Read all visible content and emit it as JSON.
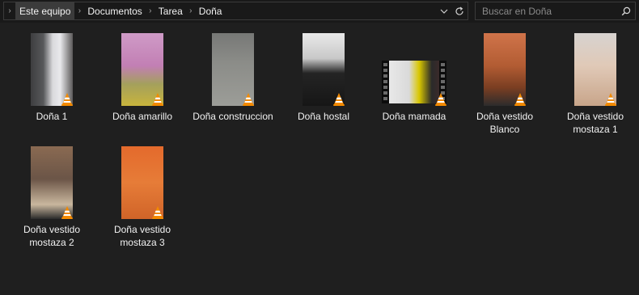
{
  "address_bar": {
    "breadcrumbs": [
      "Este equipo",
      "Documentos",
      "Tarea",
      "Doña"
    ],
    "dropdown_icon": "chevron-down-icon",
    "refresh_icon": "refresh-icon"
  },
  "search": {
    "placeholder": "Buscar en Doña",
    "value": "",
    "icon": "search-icon"
  },
  "files": [
    {
      "name": "Doña 1",
      "type": "video",
      "icon": "vlc-cone-icon"
    },
    {
      "name": "Doña amarillo",
      "type": "video",
      "icon": "vlc-cone-icon"
    },
    {
      "name": "Doña construccion",
      "type": "video",
      "icon": "vlc-cone-icon"
    },
    {
      "name": "Doña hostal",
      "type": "video",
      "icon": "vlc-cone-icon"
    },
    {
      "name": "Doña mamada",
      "type": "video",
      "icon": "vlc-cone-icon"
    },
    {
      "name": "Doña vestido Blanco",
      "type": "video",
      "icon": "vlc-cone-icon"
    },
    {
      "name": "Doña vestido mostaza 1",
      "type": "video",
      "icon": "vlc-cone-icon"
    },
    {
      "name": "Doña vestido mostaza 2",
      "type": "video",
      "icon": "vlc-cone-icon"
    },
    {
      "name": "Doña vestido mostaza 3",
      "type": "video",
      "icon": "vlc-cone-icon"
    }
  ],
  "colors": {
    "background": "#1f1f1f",
    "address_bar": "#191919",
    "border": "#3a3a3a",
    "vlc_orange": "#f38a00"
  }
}
